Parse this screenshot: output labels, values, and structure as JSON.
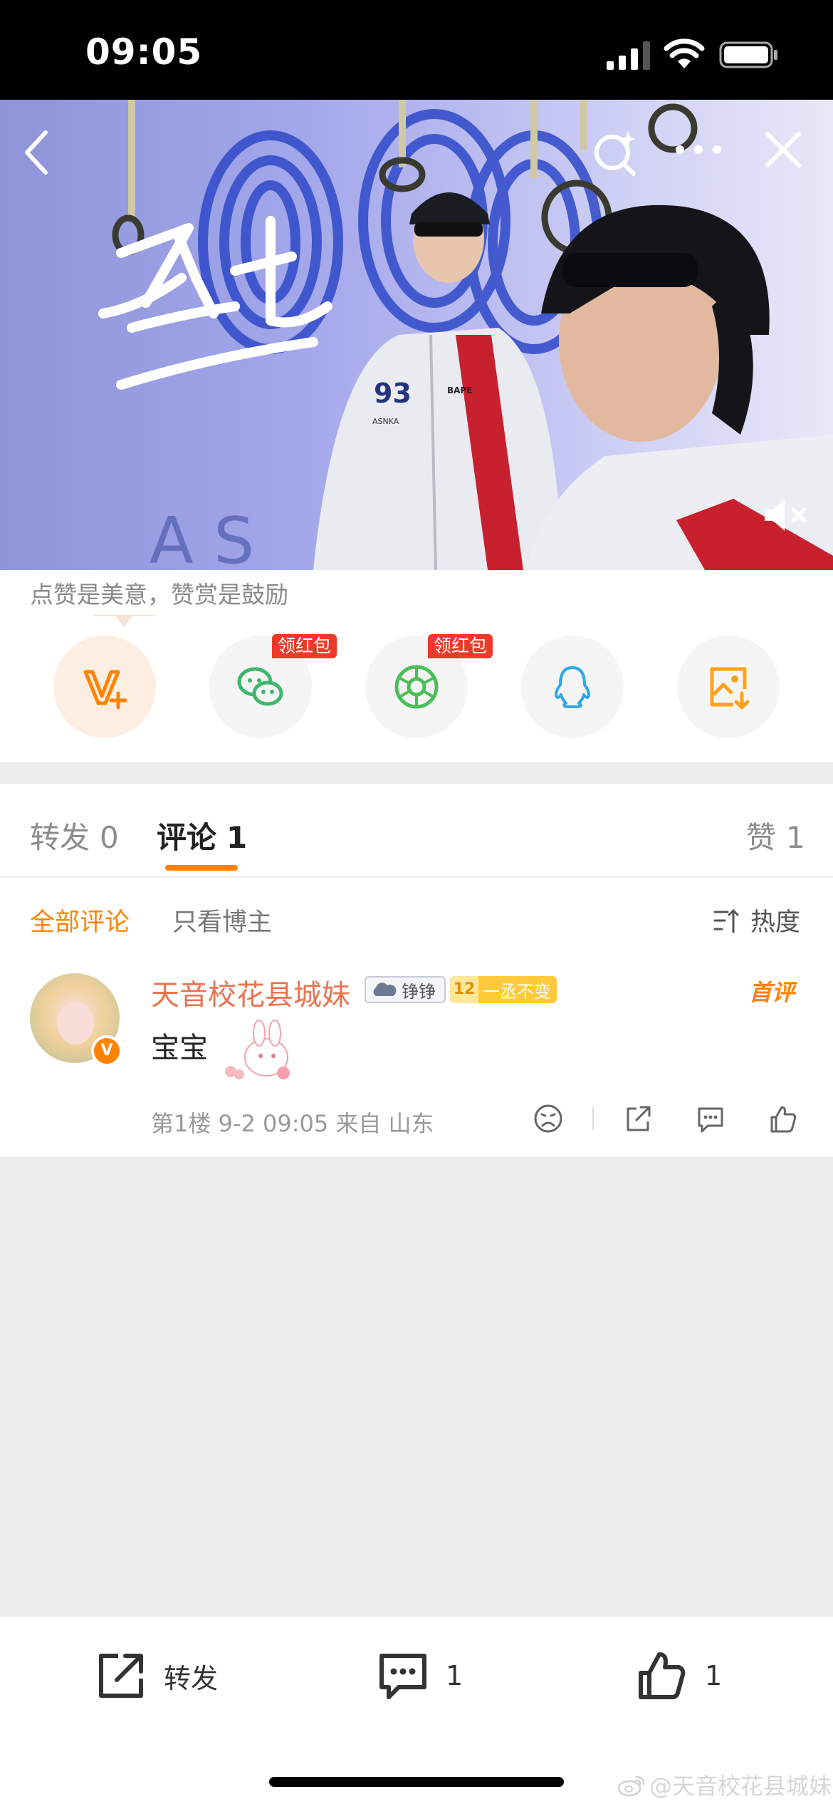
{
  "status_bar": {
    "time": "09:05"
  },
  "video": {
    "overlay_text": "丞七",
    "jacket_number": "93",
    "jacket_brand": "BAPE",
    "jacket_label": "ASNKA"
  },
  "reward": {
    "hint": "点赞是美意，赞赏是鼓励",
    "badge_wechat": "领红包",
    "badge_moments": "领红包"
  },
  "tabs": {
    "repost_label": "转发",
    "repost_count": "0",
    "comment_label": "评论",
    "comment_count": "1",
    "like_label": "赞",
    "like_count": "1"
  },
  "filters": {
    "all": "全部评论",
    "blogger": "只看博主",
    "sort": "热度"
  },
  "comment": {
    "username": "天音校花县城妹",
    "fan_badge": "铮铮",
    "level": "12",
    "level_text": "一丞不变",
    "tag": "首评",
    "text": "宝宝",
    "meta": "第1楼 9-2 09:05 来自 山东",
    "verified_mark": "V"
  },
  "bottom_bar": {
    "repost_label": "转发",
    "comment_count": "1",
    "like_count": "1"
  },
  "watermark": "@天音校花县城妹",
  "colors": {
    "accent": "#ff8200",
    "username": "#eb7350",
    "badge_red": "#ee3a2a"
  }
}
